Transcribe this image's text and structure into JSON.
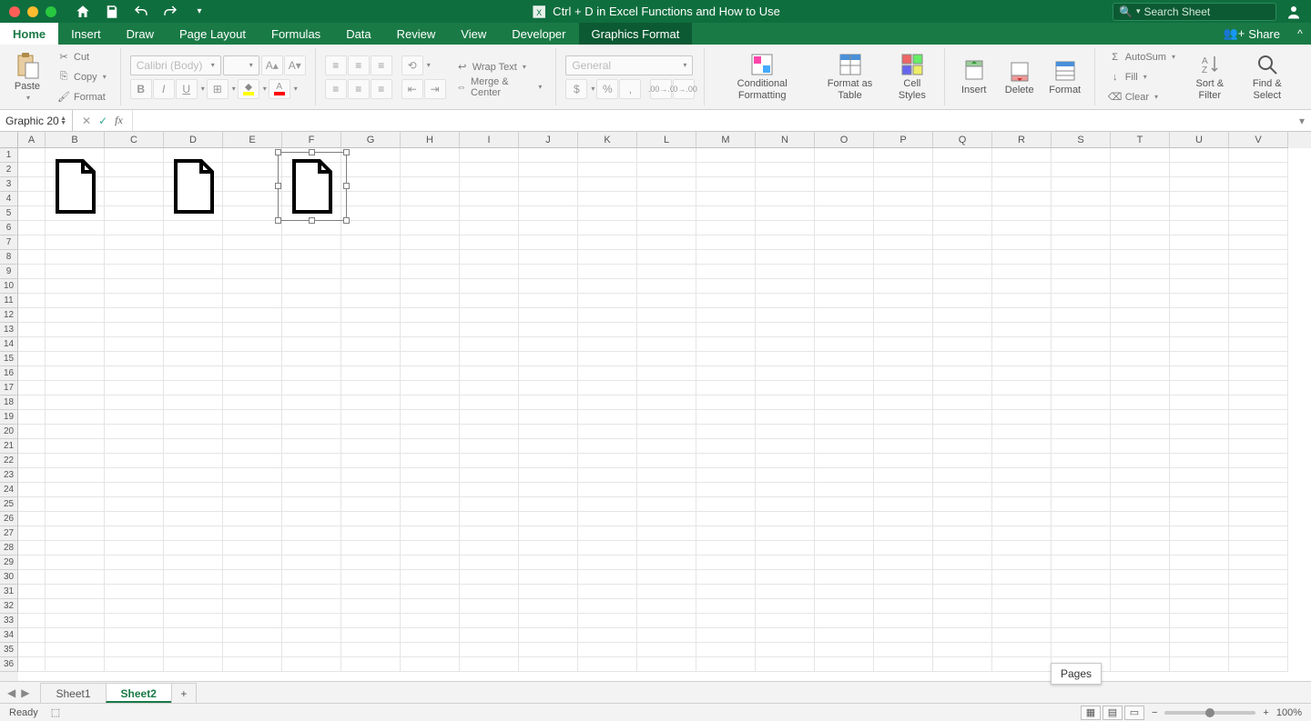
{
  "titlebar": {
    "title": "Ctrl + D in Excel Functions and How to Use",
    "search_placeholder": "Search Sheet"
  },
  "tabs": {
    "items": [
      "Home",
      "Insert",
      "Draw",
      "Page Layout",
      "Formulas",
      "Data",
      "Review",
      "View",
      "Developer",
      "Graphics Format"
    ],
    "active": "Home",
    "context": "Graphics Format",
    "share": "Share"
  },
  "ribbon": {
    "clipboard": {
      "paste": "Paste",
      "cut": "Cut",
      "copy": "Copy",
      "format": "Format"
    },
    "font": {
      "name": "Calibri (Body)",
      "size": "",
      "bold": "B",
      "italic": "I",
      "underline": "U"
    },
    "align": {
      "wrap": "Wrap Text",
      "merge": "Merge & Center"
    },
    "number": {
      "format": "General"
    },
    "styles": {
      "conditional": "Conditional Formatting",
      "table": "Format as Table",
      "cell": "Cell Styles"
    },
    "cells": {
      "insert": "Insert",
      "delete": "Delete",
      "format": "Format"
    },
    "editing": {
      "autosum": "AutoSum",
      "fill": "Fill",
      "clear": "Clear",
      "sort": "Sort & Filter",
      "find": "Find & Select"
    }
  },
  "formula_bar": {
    "namebox": "Graphic 20",
    "fx": "fx"
  },
  "grid": {
    "columns": [
      "A",
      "B",
      "C",
      "D",
      "E",
      "F",
      "G",
      "H",
      "I",
      "J",
      "K",
      "L",
      "M",
      "N",
      "O",
      "P",
      "Q",
      "R",
      "S",
      "T",
      "U",
      "V"
    ],
    "rows": [
      1,
      2,
      3,
      4,
      5,
      6,
      7,
      8,
      9,
      10,
      11,
      12,
      13,
      14,
      15,
      16,
      17,
      18,
      19,
      20,
      21,
      22,
      23,
      24,
      25,
      26,
      27,
      28,
      29,
      30,
      31,
      32,
      33,
      34,
      35,
      36
    ]
  },
  "sheets": {
    "tabs": [
      "Sheet1",
      "Sheet2"
    ],
    "active": "Sheet2",
    "tooltip": "Pages"
  },
  "statusbar": {
    "status": "Ready",
    "zoom": "100%"
  }
}
